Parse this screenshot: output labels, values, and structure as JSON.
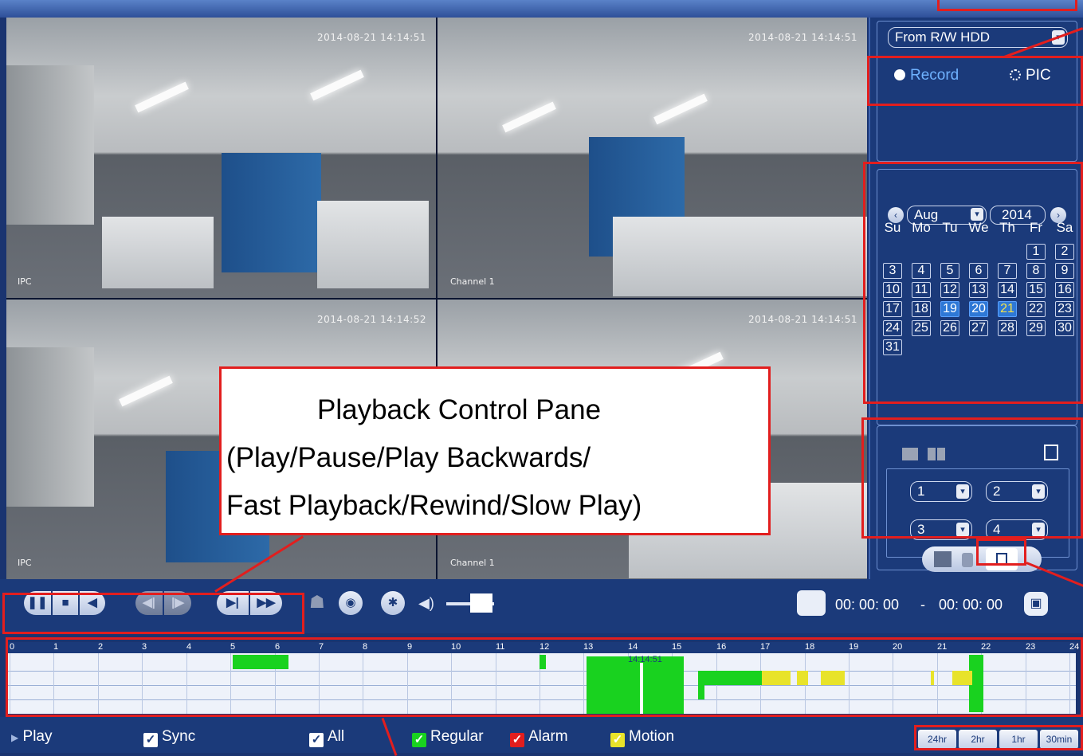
{
  "video": {
    "tiles": [
      {
        "timestamp": "2014-08-21 14:14:51",
        "channel": "IPC"
      },
      {
        "timestamp": "2014-08-21 14:14:51",
        "channel": "Channel 1"
      },
      {
        "timestamp": "2014-08-21 14:14:52",
        "channel": "IPC"
      },
      {
        "timestamp": "2014-08-21 14:14:51",
        "channel": "Channel 1"
      }
    ]
  },
  "sidebar": {
    "source": "From R/W HDD",
    "mode_record": "Record",
    "mode_pic": "PIC",
    "month": "Aug",
    "year": "2014",
    "weekdays": [
      "Su",
      "Mo",
      "Tu",
      "We",
      "Th",
      "Fr",
      "Sa"
    ],
    "calendar_weeks": [
      [
        "",
        "",
        "",
        "",
        "",
        "1",
        "2"
      ],
      [
        "3",
        "4",
        "5",
        "6",
        "7",
        "8",
        "9"
      ],
      [
        "10",
        "11",
        "12",
        "13",
        "14",
        "15",
        "16"
      ],
      [
        "17",
        "18",
        "19",
        "20",
        "21",
        "22",
        "23"
      ],
      [
        "24",
        "25",
        "26",
        "27",
        "28",
        "29",
        "30"
      ],
      [
        "31",
        "",
        "",
        "",
        "",
        "",
        ""
      ]
    ],
    "highlight_blue": [
      "19",
      "20"
    ],
    "highlight_selected": "21",
    "channels": [
      "1",
      "2",
      "3",
      "4"
    ]
  },
  "toolbar": {
    "time_start": "00: 00: 00",
    "time_sep": "-",
    "time_end": "00: 00: 00"
  },
  "timeline": {
    "hours": [
      "0",
      "1",
      "2",
      "3",
      "4",
      "5",
      "6",
      "7",
      "8",
      "9",
      "10",
      "11",
      "12",
      "13",
      "14",
      "15",
      "16",
      "17",
      "18",
      "19",
      "20",
      "21",
      "22",
      "23",
      "24"
    ],
    "cursor_time": "14:14:51"
  },
  "legend": {
    "play": "Play",
    "sync": "Sync",
    "all": "All",
    "regular": "Regular",
    "alarm": "Alarm",
    "motion": "Motion",
    "colors": {
      "regular": "#19d21f",
      "alarm": "#e21e1e",
      "motion": "#e8e32a"
    }
  },
  "zoom": [
    "24hr",
    "2hr",
    "1hr",
    "30min"
  ],
  "callout": {
    "line1": "Playback Control Pane",
    "line2": "(Play/Pause/Play Backwards/",
    "line3": "Fast Playback/Rewind/Slow Play)"
  }
}
